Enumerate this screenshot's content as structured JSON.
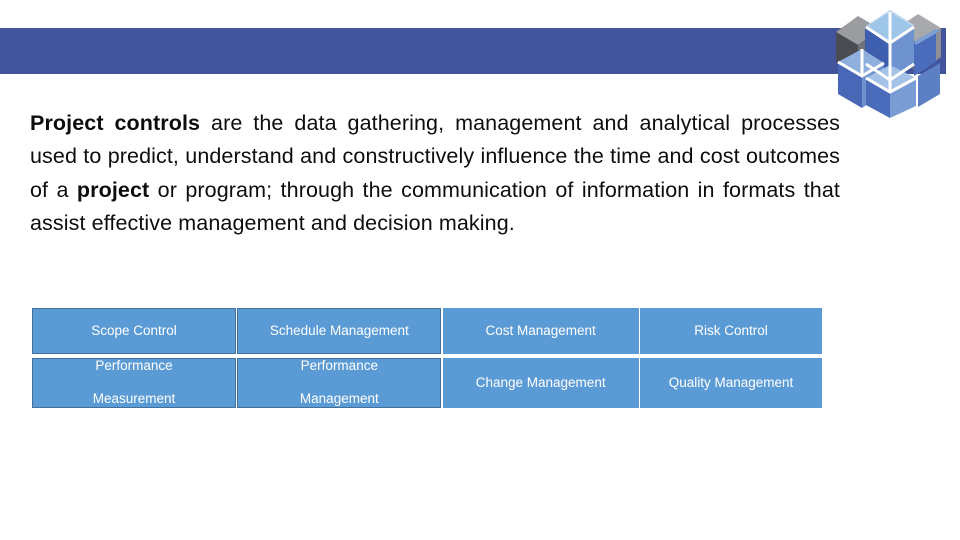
{
  "slide": {
    "banner_color": "#41549c",
    "logo_icon": "cube-logo-icon",
    "background_color": "#ffffff"
  },
  "content": {
    "paragraph": {
      "lead_bold": "Project controls",
      "segment_1": " are the data gathering, management and analytical processes used to predict, understand and constructively influence the time and cost outcomes of a ",
      "bold_2": "project",
      "segment_2": " or program; through the communication of information in formats that assist effective management and decision making.",
      "full_text": "Project controls are the data gathering, management and analytical processes used to predict, understand and constructively influence the time and cost outcomes of a project or program; through the communication of information in formats that assist effective management and decision making."
    }
  },
  "controls_table": {
    "cell_fill_color": "#5b9bd5",
    "cell_border_color": "#41709c",
    "text_color": "#ffffff",
    "columns": 4,
    "rows": 2,
    "cells": [
      {
        "id": "scope-control",
        "label": "Scope Control",
        "row": 1,
        "col": 1,
        "bordered": true
      },
      {
        "id": "schedule-management",
        "label": "Schedule Management",
        "row": 1,
        "col": 2,
        "bordered": true
      },
      {
        "id": "cost-management",
        "label": "Cost Management",
        "row": 1,
        "col": 3,
        "bordered": false
      },
      {
        "id": "risk-control",
        "label": "Risk Control",
        "row": 1,
        "col": 4,
        "bordered": false
      },
      {
        "id": "performance-measurement",
        "label": "Performance Measurement",
        "row": 2,
        "col": 1,
        "bordered": true
      },
      {
        "id": "performance-management",
        "label": "Performance Management",
        "row": 2,
        "col": 2,
        "bordered": true
      },
      {
        "id": "change-management",
        "label": "Change Management",
        "row": 2,
        "col": 3,
        "bordered": false
      },
      {
        "id": "quality-management",
        "label": "Quality Management",
        "row": 2,
        "col": 4,
        "bordered": false
      }
    ],
    "cell_labels": {
      "r1c1": "Scope Control",
      "r1c2": "Schedule Management",
      "r1c3": "Cost Management",
      "r1c4": "Risk Control",
      "r2c1_line1": "Performance",
      "r2c1_line2": "Measurement",
      "r2c2_line1": "Performance",
      "r2c2_line2": "Management",
      "r2c3": "Change Management",
      "r2c4": "Quality Management"
    }
  }
}
